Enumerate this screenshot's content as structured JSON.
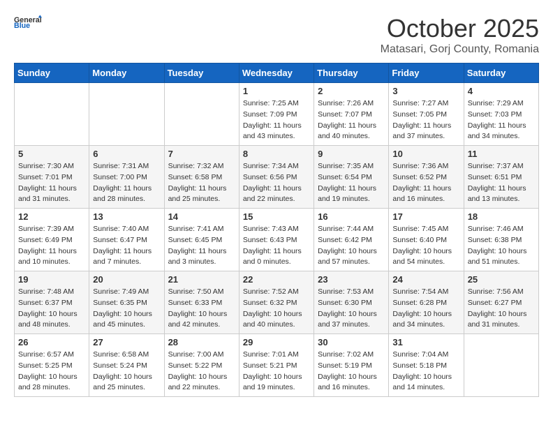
{
  "header": {
    "logo_general": "General",
    "logo_blue": "Blue",
    "month": "October 2025",
    "location": "Matasari, Gorj County, Romania"
  },
  "weekdays": [
    "Sunday",
    "Monday",
    "Tuesday",
    "Wednesday",
    "Thursday",
    "Friday",
    "Saturday"
  ],
  "weeks": [
    [
      {
        "day": "",
        "info": ""
      },
      {
        "day": "",
        "info": ""
      },
      {
        "day": "",
        "info": ""
      },
      {
        "day": "1",
        "info": "Sunrise: 7:25 AM\nSunset: 7:09 PM\nDaylight: 11 hours\nand 43 minutes."
      },
      {
        "day": "2",
        "info": "Sunrise: 7:26 AM\nSunset: 7:07 PM\nDaylight: 11 hours\nand 40 minutes."
      },
      {
        "day": "3",
        "info": "Sunrise: 7:27 AM\nSunset: 7:05 PM\nDaylight: 11 hours\nand 37 minutes."
      },
      {
        "day": "4",
        "info": "Sunrise: 7:29 AM\nSunset: 7:03 PM\nDaylight: 11 hours\nand 34 minutes."
      }
    ],
    [
      {
        "day": "5",
        "info": "Sunrise: 7:30 AM\nSunset: 7:01 PM\nDaylight: 11 hours\nand 31 minutes."
      },
      {
        "day": "6",
        "info": "Sunrise: 7:31 AM\nSunset: 7:00 PM\nDaylight: 11 hours\nand 28 minutes."
      },
      {
        "day": "7",
        "info": "Sunrise: 7:32 AM\nSunset: 6:58 PM\nDaylight: 11 hours\nand 25 minutes."
      },
      {
        "day": "8",
        "info": "Sunrise: 7:34 AM\nSunset: 6:56 PM\nDaylight: 11 hours\nand 22 minutes."
      },
      {
        "day": "9",
        "info": "Sunrise: 7:35 AM\nSunset: 6:54 PM\nDaylight: 11 hours\nand 19 minutes."
      },
      {
        "day": "10",
        "info": "Sunrise: 7:36 AM\nSunset: 6:52 PM\nDaylight: 11 hours\nand 16 minutes."
      },
      {
        "day": "11",
        "info": "Sunrise: 7:37 AM\nSunset: 6:51 PM\nDaylight: 11 hours\nand 13 minutes."
      }
    ],
    [
      {
        "day": "12",
        "info": "Sunrise: 7:39 AM\nSunset: 6:49 PM\nDaylight: 11 hours\nand 10 minutes."
      },
      {
        "day": "13",
        "info": "Sunrise: 7:40 AM\nSunset: 6:47 PM\nDaylight: 11 hours\nand 7 minutes."
      },
      {
        "day": "14",
        "info": "Sunrise: 7:41 AM\nSunset: 6:45 PM\nDaylight: 11 hours\nand 3 minutes."
      },
      {
        "day": "15",
        "info": "Sunrise: 7:43 AM\nSunset: 6:43 PM\nDaylight: 11 hours\nand 0 minutes."
      },
      {
        "day": "16",
        "info": "Sunrise: 7:44 AM\nSunset: 6:42 PM\nDaylight: 10 hours\nand 57 minutes."
      },
      {
        "day": "17",
        "info": "Sunrise: 7:45 AM\nSunset: 6:40 PM\nDaylight: 10 hours\nand 54 minutes."
      },
      {
        "day": "18",
        "info": "Sunrise: 7:46 AM\nSunset: 6:38 PM\nDaylight: 10 hours\nand 51 minutes."
      }
    ],
    [
      {
        "day": "19",
        "info": "Sunrise: 7:48 AM\nSunset: 6:37 PM\nDaylight: 10 hours\nand 48 minutes."
      },
      {
        "day": "20",
        "info": "Sunrise: 7:49 AM\nSunset: 6:35 PM\nDaylight: 10 hours\nand 45 minutes."
      },
      {
        "day": "21",
        "info": "Sunrise: 7:50 AM\nSunset: 6:33 PM\nDaylight: 10 hours\nand 42 minutes."
      },
      {
        "day": "22",
        "info": "Sunrise: 7:52 AM\nSunset: 6:32 PM\nDaylight: 10 hours\nand 40 minutes."
      },
      {
        "day": "23",
        "info": "Sunrise: 7:53 AM\nSunset: 6:30 PM\nDaylight: 10 hours\nand 37 minutes."
      },
      {
        "day": "24",
        "info": "Sunrise: 7:54 AM\nSunset: 6:28 PM\nDaylight: 10 hours\nand 34 minutes."
      },
      {
        "day": "25",
        "info": "Sunrise: 7:56 AM\nSunset: 6:27 PM\nDaylight: 10 hours\nand 31 minutes."
      }
    ],
    [
      {
        "day": "26",
        "info": "Sunrise: 6:57 AM\nSunset: 5:25 PM\nDaylight: 10 hours\nand 28 minutes."
      },
      {
        "day": "27",
        "info": "Sunrise: 6:58 AM\nSunset: 5:24 PM\nDaylight: 10 hours\nand 25 minutes."
      },
      {
        "day": "28",
        "info": "Sunrise: 7:00 AM\nSunset: 5:22 PM\nDaylight: 10 hours\nand 22 minutes."
      },
      {
        "day": "29",
        "info": "Sunrise: 7:01 AM\nSunset: 5:21 PM\nDaylight: 10 hours\nand 19 minutes."
      },
      {
        "day": "30",
        "info": "Sunrise: 7:02 AM\nSunset: 5:19 PM\nDaylight: 10 hours\nand 16 minutes."
      },
      {
        "day": "31",
        "info": "Sunrise: 7:04 AM\nSunset: 5:18 PM\nDaylight: 10 hours\nand 14 minutes."
      },
      {
        "day": "",
        "info": ""
      }
    ]
  ]
}
